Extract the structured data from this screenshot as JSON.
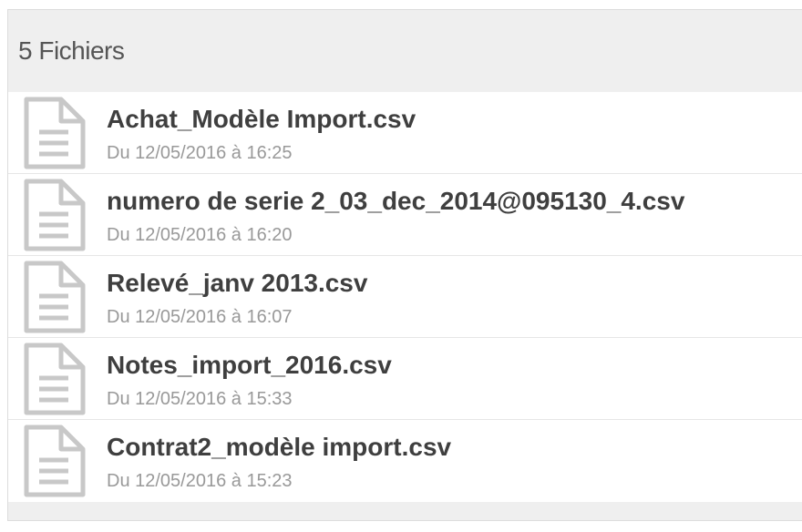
{
  "header": {
    "title": "5 Fichiers"
  },
  "files": [
    {
      "name": "Achat_Modèle Import.csv",
      "date": "Du 12/05/2016 à 16:25",
      "icon": "file-document-icon"
    },
    {
      "name": "numero de serie 2_03_dec_2014@095130_4.csv",
      "date": "Du 12/05/2016 à 16:20",
      "icon": "file-document-icon"
    },
    {
      "name": "Relevé_janv 2013.csv",
      "date": "Du 12/05/2016 à 16:07",
      "icon": "file-document-icon"
    },
    {
      "name": "Notes_import_2016.csv",
      "date": "Du 12/05/2016 à 15:33",
      "icon": "file-document-icon"
    },
    {
      "name": "Contrat2_modèle import.csv",
      "date": "Du 12/05/2016 à 15:23",
      "icon": "file-document-icon"
    }
  ],
  "colors": {
    "header_bg": "#efefef",
    "row_bg": "#ffffff",
    "name_text": "#3f3f3f",
    "date_text": "#999999",
    "icon_stroke": "#c8c8c8"
  }
}
